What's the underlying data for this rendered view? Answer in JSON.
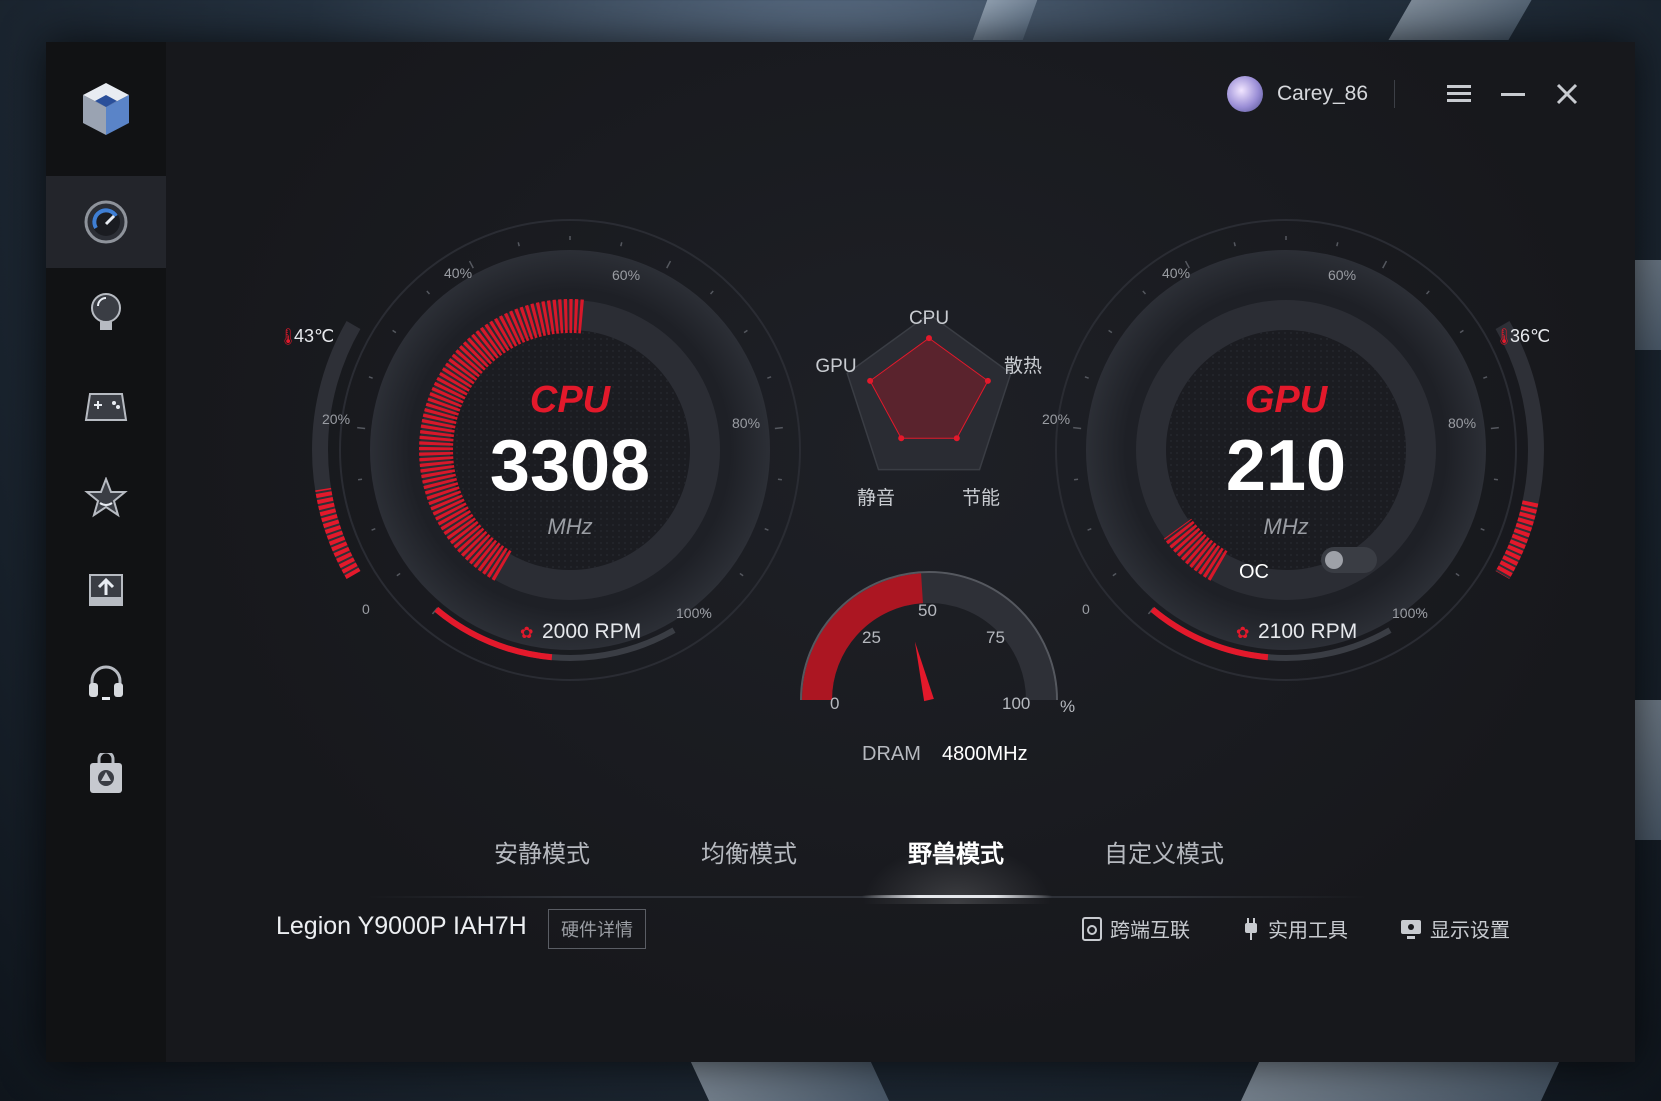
{
  "user": {
    "name": "Carey_86"
  },
  "window_controls": {
    "menu_icon": "menu-icon",
    "minimize_icon": "minimize-icon",
    "close_icon": "close-icon"
  },
  "sidebar": {
    "items": [
      {
        "icon": "dashboard-gauge-icon",
        "active": true
      },
      {
        "icon": "lightbulb-icon"
      },
      {
        "icon": "gamepad-icon"
      },
      {
        "icon": "star-icon"
      },
      {
        "icon": "upload-icon"
      },
      {
        "icon": "headset-icon"
      },
      {
        "icon": "shopping-bag-icon"
      }
    ]
  },
  "cpu": {
    "label": "CPU",
    "value": "3308",
    "unit": "MHz",
    "temp": "43℃",
    "fan": "2000 RPM",
    "scale": [
      "0",
      "20%",
      "40%",
      "60%",
      "80%",
      "100%"
    ],
    "load_fraction": 0.52,
    "temp_fraction": 0.35
  },
  "gpu": {
    "label": "GPU",
    "value": "210",
    "unit": "MHz",
    "temp": "36℃",
    "fan": "2100 RPM",
    "oc_label": "OC",
    "oc_enabled": false,
    "scale": [
      "0",
      "20%",
      "40%",
      "60%",
      "80%",
      "100%"
    ],
    "load_fraction": 0.08,
    "temp_fraction": 0.3
  },
  "radar": {
    "labels": [
      "CPU",
      "散热",
      "节能",
      "静音",
      "GPU"
    ]
  },
  "dram": {
    "label": "DRAM",
    "value": "4800MHz",
    "scale": [
      "0",
      "25",
      "50",
      "75",
      "100"
    ],
    "unit": "%",
    "percent": 48
  },
  "modes": {
    "tabs": [
      "安静模式",
      "均衡模式",
      "野兽模式",
      "自定义模式"
    ],
    "active_index": 2
  },
  "footer": {
    "model": "Legion Y9000P IAH7H",
    "hw_details": "硬件详情",
    "links": [
      "跨端互联",
      "实用工具",
      "显示设置"
    ]
  },
  "colors": {
    "accent": "#e3192b",
    "background": "#17181c",
    "sidebar": "#111214"
  }
}
